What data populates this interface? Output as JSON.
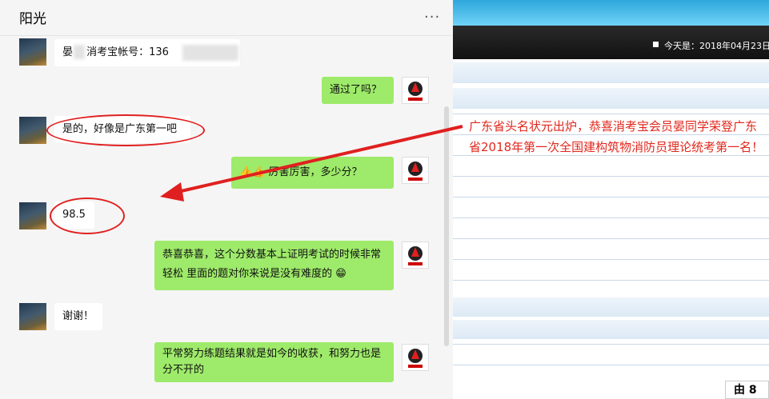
{
  "chat": {
    "title": "阳光",
    "more_label": "···",
    "messages": [
      {
        "side": "in",
        "text": "晏 ，消考宝帐号：136"
      },
      {
        "side": "out",
        "text": "通过了吗？"
      },
      {
        "side": "in",
        "text": "是的，好像是广东第一吧"
      },
      {
        "side": "out",
        "text": "厉害厉害，多少分？"
      },
      {
        "side": "in",
        "text": "98.5"
      },
      {
        "side": "out",
        "text": "恭喜恭喜，这个分数基本上证明考试的时候非常轻松 里面的题对你来说是没有难度的"
      },
      {
        "side": "in",
        "text": "谢谢！"
      },
      {
        "side": "out",
        "text": "平常努力练题结果就是如今的收获，和努力也是分不开的"
      }
    ],
    "emoji": {
      "thumbs": "👍👍",
      "grin": "😁"
    }
  },
  "web": {
    "date_label": "今天是：2018年04月23日",
    "notice": "广东省头名状元出炉，恭喜消考宝会员晏同学荣登广东省2018年第一次全国建构筑物消防员理论统考第一名！",
    "corner_text": "由 8"
  },
  "colors": {
    "accent": "#e0281e",
    "bubble_out": "#9eea6a",
    "topbar": "#2fa7dc"
  }
}
